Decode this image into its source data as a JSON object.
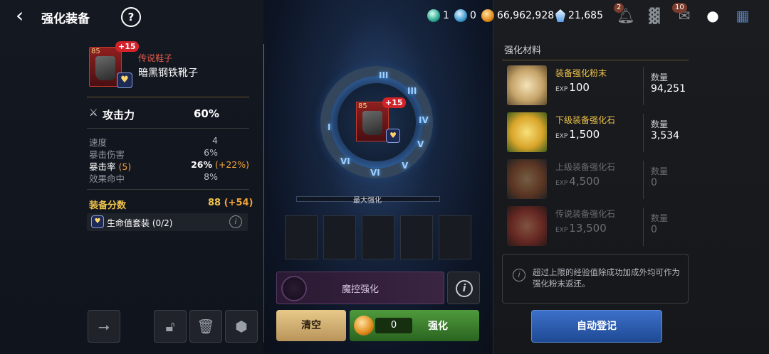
{
  "header": {
    "back_icon": "chevron-left-icon",
    "title": "强化装备",
    "help_label": "?",
    "currencies": [
      {
        "icon": "teal-gem-icon",
        "value": "1"
      },
      {
        "icon": "blue-gem-icon",
        "value": "0"
      },
      {
        "icon": "gold-coin-icon",
        "value": "66,962,928"
      },
      {
        "icon": "crystal-icon",
        "value": "21,685"
      }
    ],
    "notification_count": "2",
    "mail_count": "10"
  },
  "item": {
    "level": "85",
    "plus": "+15",
    "rarity": "传说鞋子",
    "name": "暗黑钢铁靴子",
    "main_stat": {
      "label": "攻击力",
      "value": "60%"
    },
    "sub_stats": [
      {
        "label": "速度",
        "value": "4",
        "bonus": ""
      },
      {
        "label": "暴击伤害",
        "value": "6%",
        "bonus": ""
      },
      {
        "label": "暴击率",
        "label_extra": " (5)",
        "value": "26%",
        "bonus": " (+22%)"
      },
      {
        "label": "效果命中",
        "value": "8%",
        "bonus": ""
      }
    ],
    "score_label": "装备分数",
    "score_value": "88",
    "score_bonus": " (+54)",
    "set_label": "生命值套装 (0/2)"
  },
  "center": {
    "runes": [
      "III",
      "III",
      "IV",
      "I",
      "V",
      "V",
      "VI",
      "VI"
    ],
    "max_label": "最大强化",
    "magic_label": "魔控强化",
    "clear_label": "清空",
    "enhance_cost": "0",
    "enhance_label": "强化"
  },
  "materials": {
    "title": "强化材料",
    "qty_label": "数量",
    "exp_prefix": "EXP",
    "items": [
      {
        "name": "装备强化粉末",
        "exp": "100",
        "qty": "94,251",
        "enabled": true
      },
      {
        "name": "下级装备强化石",
        "exp": "1,500",
        "qty": "3,534",
        "enabled": true
      },
      {
        "name": "上级装备强化石",
        "exp": "4,500",
        "qty": "0",
        "enabled": false
      },
      {
        "name": "传说装备强化石",
        "exp": "13,500",
        "qty": "0",
        "enabled": false
      }
    ],
    "note": "超过上限的经验值除成功加成外均可作为强化粉末返还。",
    "auto_label": "自动登记"
  },
  "colors": {
    "accent_gold": "#f0c34a",
    "bonus_orange": "#f0a23a",
    "rarity_red": "#e05a4a",
    "enhance_green": "#4f9a3c",
    "auto_blue": "#3c70c9"
  }
}
